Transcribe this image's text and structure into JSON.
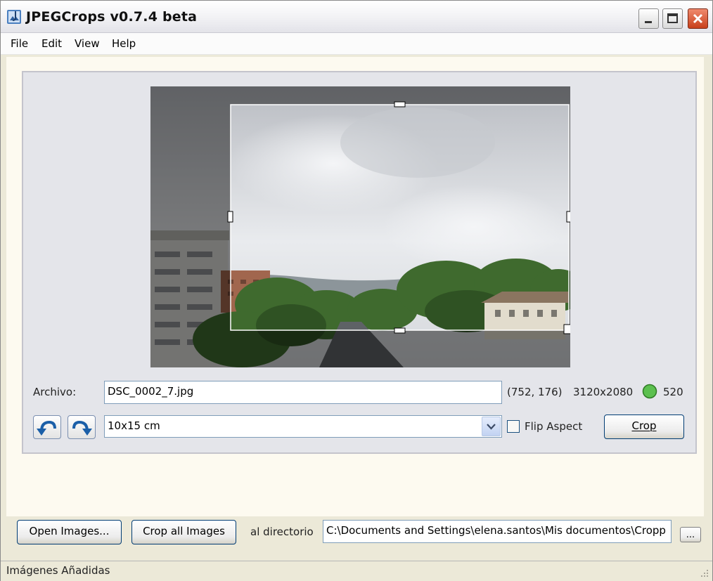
{
  "window": {
    "title": "JPEGCrops v0.7.4 beta",
    "controls": [
      "minimize",
      "maximize",
      "close"
    ]
  },
  "menu": [
    "File",
    "Edit",
    "View",
    "Help"
  ],
  "preview": {
    "image": "landscape photo of cloudy sky over apartment buildings and trees",
    "crop_selection": "highlighted crop rectangle with resize handles"
  },
  "file": {
    "label": "Archivo:",
    "name": "DSC_0002_7.jpg",
    "offset": "(752, 176)",
    "dimensions": "3120x2080",
    "status_color": "#4fb84a",
    "dpi": "520"
  },
  "controls": {
    "rotate_left_icon": "rotate-left-icon",
    "rotate_right_icon": "rotate-right-icon",
    "size_preset": "10x15 cm",
    "flip_aspect_label": "Flip Aspect",
    "flip_aspect_checked": false,
    "crop_label": "Crop"
  },
  "bottom": {
    "open_images_label": "Open Images...",
    "crop_all_label": "Crop all Images",
    "dir_label": "al directorio",
    "dir_path": "C:\\Documents and Settings\\elena.santos\\Mis documentos\\Cropp",
    "browse_label": "..."
  },
  "statusbar": {
    "text": "Imágenes Añadidas"
  }
}
